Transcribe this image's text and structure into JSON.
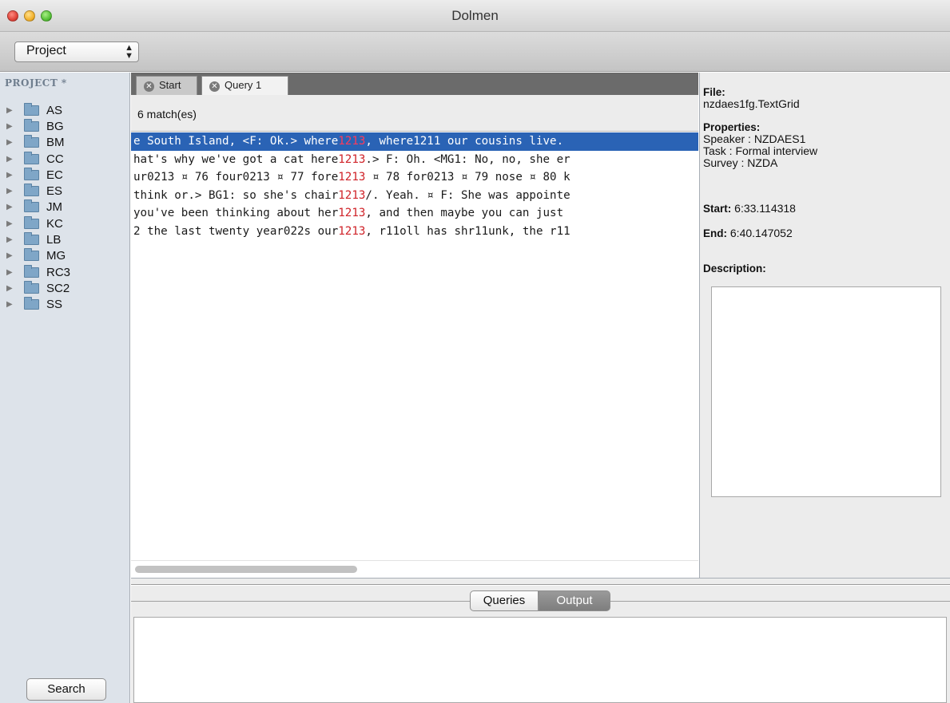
{
  "window": {
    "title": "Dolmen"
  },
  "toolbar": {
    "project_select": "Project",
    "select_arrows": "⬍"
  },
  "sidebar": {
    "header": "PROJECT *",
    "items": [
      {
        "label": "AS"
      },
      {
        "label": "BG"
      },
      {
        "label": "BM"
      },
      {
        "label": "CC"
      },
      {
        "label": "EC"
      },
      {
        "label": "ES"
      },
      {
        "label": "JM"
      },
      {
        "label": "KC"
      },
      {
        "label": "LB"
      },
      {
        "label": "MG"
      },
      {
        "label": "RC3"
      },
      {
        "label": "SC2"
      },
      {
        "label": "SS"
      }
    ],
    "search_button": "Search"
  },
  "tabs": [
    {
      "label": "Start",
      "icon": "close-icon"
    },
    {
      "label": "Query 1",
      "icon": "close-icon"
    }
  ],
  "results": {
    "match_count": "6 match(es)",
    "rows": [
      {
        "before": "e South Island, <F: Ok.> where",
        "hit": "1213",
        "after": ", where1211 our cousins live.",
        "selected": true
      },
      {
        "before": "hat's why we've got a cat here",
        "hit": "1213",
        "after": ".> F: Oh. <MG1: No, no, she er",
        "selected": false
      },
      {
        "before": "ur0213 ¤ 76 four0213 ¤ 77 fore",
        "hit": "1213",
        "after": " ¤ 78 for0213 ¤ 79 nose ¤ 80 k",
        "selected": false
      },
      {
        "before": "think or.> BG1: so she's chair",
        "hit": "1213",
        "after": "/. Yeah. ¤ F: She was appointe",
        "selected": false
      },
      {
        "before": "you've been thinking about her",
        "hit": "1213",
        "after": ", and then maybe you can just",
        "selected": false
      },
      {
        "before": "2 the last twenty year022s our",
        "hit": "1213",
        "after": ", r11oll has shr11unk, the r11",
        "selected": false
      }
    ]
  },
  "info": {
    "file_label": "File:",
    "file_value": "nzdaes1fg.TextGrid",
    "properties_label": "Properties:",
    "properties": [
      "Speaker : NZDAES1",
      "Task : Formal interview",
      "Survey : NZDA"
    ],
    "start_label": "Start:",
    "start_value": "6:33.114318",
    "end_label": "End:",
    "end_value": "6:40.147052",
    "description_label": "Description:"
  },
  "bottom": {
    "tabs": [
      "Queries",
      "Output"
    ],
    "active_tab": "Output"
  },
  "colors": {
    "selection": "#2a63b5",
    "hit": "#d0242a",
    "sidebar_bg": "#dde3ea"
  }
}
